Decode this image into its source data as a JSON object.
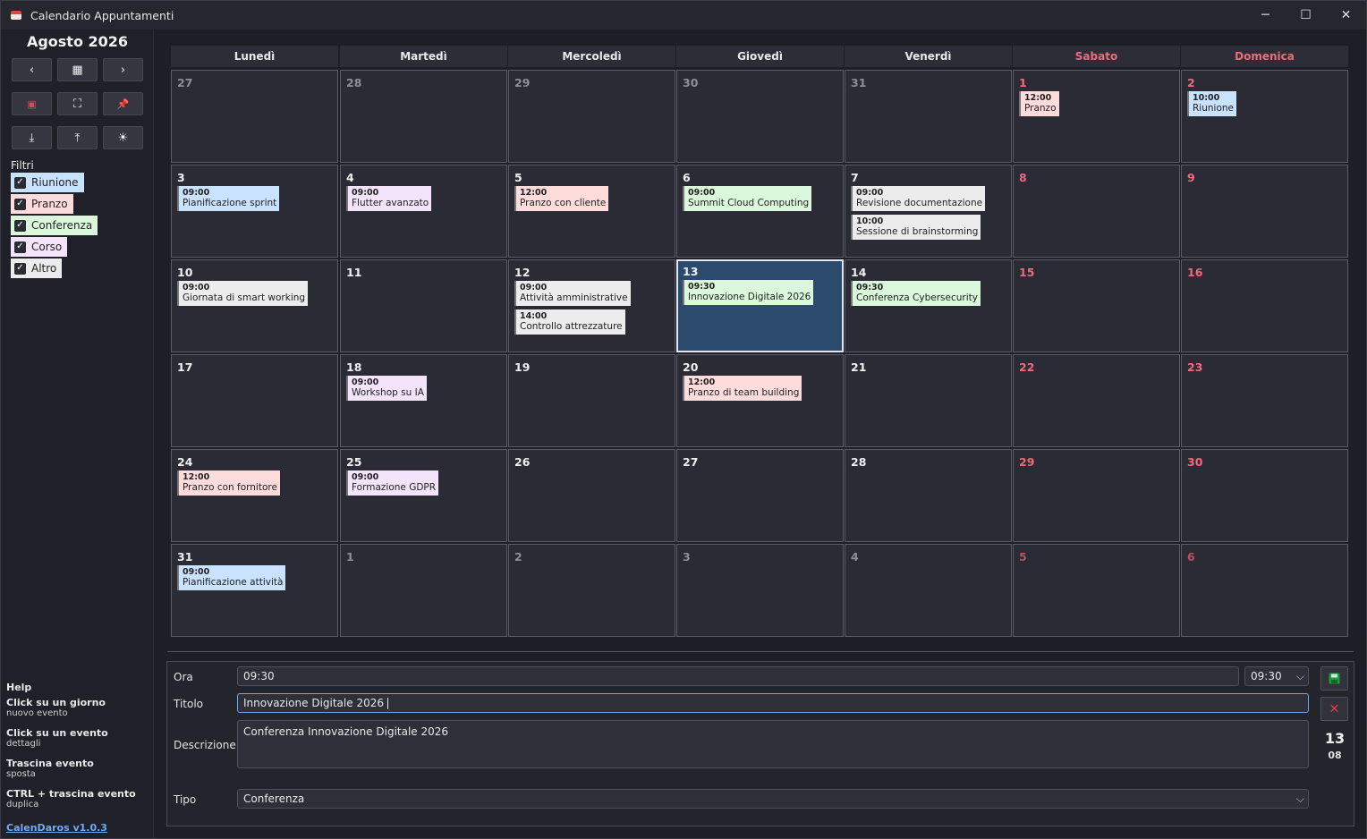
{
  "window": {
    "title": "Calendario Appuntamenti",
    "minimize": "─",
    "maximize": "☐",
    "close": "✕"
  },
  "sidebar": {
    "month_title": "Agosto 2026",
    "buttons": [
      {
        "name": "prev-month-button",
        "icon": "chevron-left-icon",
        "glyph": "‹"
      },
      {
        "name": "today-button",
        "icon": "calendar-icon",
        "glyph": "▦"
      },
      {
        "name": "next-month-button",
        "icon": "chevron-right-icon",
        "glyph": "›"
      },
      {
        "name": "language-button",
        "icon": "uk-flag-icon",
        "glyph": "▣"
      },
      {
        "name": "fullscreen-button",
        "icon": "expand-icon",
        "glyph": "⛶"
      },
      {
        "name": "pin-button",
        "icon": "pin-icon",
        "glyph": "📌"
      },
      {
        "name": "import-button",
        "icon": "download-icon",
        "glyph": "⤓"
      },
      {
        "name": "export-button",
        "icon": "upload-icon",
        "glyph": "⤒"
      },
      {
        "name": "theme-button",
        "icon": "sun-icon",
        "glyph": "☀"
      }
    ],
    "filters_label": "Filtri",
    "filters": [
      {
        "label": "Riunione",
        "color": "#c9e2ff",
        "checked": true
      },
      {
        "label": "Pranzo",
        "color": "#ffdcdc",
        "checked": true
      },
      {
        "label": "Conferenza",
        "color": "#dcf8dc",
        "checked": true
      },
      {
        "label": "Corso",
        "color": "#f3e3fb",
        "checked": true
      },
      {
        "label": "Altro",
        "color": "#ececec",
        "checked": true
      }
    ],
    "help_title": "Help",
    "help": [
      {
        "action": "Click su un giorno",
        "result": "nuovo evento"
      },
      {
        "action": "Click su un evento",
        "result": "dettagli"
      },
      {
        "action": "Trascina evento",
        "result": "sposta"
      },
      {
        "action": "CTRL + trascina evento",
        "result": "duplica"
      }
    ],
    "version": "CalenDaros v1.0.3"
  },
  "calendar": {
    "weekdays": [
      "Lunedì",
      "Martedì",
      "Mercoledì",
      "Giovedì",
      "Venerdì",
      "Sabato",
      "Domenica"
    ],
    "weeks": [
      [
        {
          "day": "27",
          "other": true
        },
        {
          "day": "28",
          "other": true
        },
        {
          "day": "29",
          "other": true
        },
        {
          "day": "30",
          "other": true
        },
        {
          "day": "31",
          "other": true
        },
        {
          "day": "1",
          "events": [
            {
              "time": "12:00",
              "title": "Pranzo",
              "type": "pranzo"
            }
          ]
        },
        {
          "day": "2",
          "events": [
            {
              "time": "10:00",
              "title": "Riunione",
              "type": "riunione"
            }
          ]
        }
      ],
      [
        {
          "day": "3",
          "events": [
            {
              "time": "09:00",
              "title": "Pianificazione sprint",
              "type": "riunione"
            }
          ]
        },
        {
          "day": "4",
          "events": [
            {
              "time": "09:00",
              "title": "Flutter avanzato",
              "type": "corso"
            }
          ]
        },
        {
          "day": "5",
          "events": [
            {
              "time": "12:00",
              "title": "Pranzo con cliente",
              "type": "pranzo"
            }
          ]
        },
        {
          "day": "6",
          "events": [
            {
              "time": "09:00",
              "title": "Summit Cloud Computing",
              "type": "conferenza"
            }
          ]
        },
        {
          "day": "7",
          "events": [
            {
              "time": "09:00",
              "title": "Revisione documentazione",
              "type": "altro"
            },
            {
              "time": "10:00",
              "title": "Sessione di brainstorming",
              "type": "altro"
            }
          ]
        },
        {
          "day": "8"
        },
        {
          "day": "9"
        }
      ],
      [
        {
          "day": "10",
          "events": [
            {
              "time": "09:00",
              "title": "Giornata di smart working",
              "type": "altro"
            }
          ]
        },
        {
          "day": "11"
        },
        {
          "day": "12",
          "events": [
            {
              "time": "09:00",
              "title": "Attività amministrative",
              "type": "altro"
            },
            {
              "time": "14:00",
              "title": "Controllo attrezzature",
              "type": "altro"
            }
          ]
        },
        {
          "day": "13",
          "selected": true,
          "events": [
            {
              "time": "09:30",
              "title": "Innovazione Digitale 2026",
              "type": "conferenza"
            }
          ]
        },
        {
          "day": "14",
          "events": [
            {
              "time": "09:30",
              "title": "Conferenza Cybersecurity",
              "type": "conferenza"
            }
          ]
        },
        {
          "day": "15"
        },
        {
          "day": "16"
        }
      ],
      [
        {
          "day": "17"
        },
        {
          "day": "18",
          "events": [
            {
              "time": "09:00",
              "title": "Workshop su IA",
              "type": "corso"
            }
          ]
        },
        {
          "day": "19"
        },
        {
          "day": "20",
          "events": [
            {
              "time": "12:00",
              "title": "Pranzo di team building",
              "type": "pranzo"
            }
          ]
        },
        {
          "day": "21"
        },
        {
          "day": "22"
        },
        {
          "day": "23"
        }
      ],
      [
        {
          "day": "24",
          "events": [
            {
              "time": "12:00",
              "title": "Pranzo con fornitore",
              "type": "pranzo"
            }
          ]
        },
        {
          "day": "25",
          "events": [
            {
              "time": "09:00",
              "title": "Formazione GDPR",
              "type": "corso"
            }
          ]
        },
        {
          "day": "26"
        },
        {
          "day": "27"
        },
        {
          "day": "28"
        },
        {
          "day": "29"
        },
        {
          "day": "30"
        }
      ],
      [
        {
          "day": "31",
          "events": [
            {
              "time": "09:00",
              "title": "Pianificazione attività",
              "type": "riunione"
            }
          ]
        },
        {
          "day": "1",
          "other": true
        },
        {
          "day": "2",
          "other": true
        },
        {
          "day": "3",
          "other": true
        },
        {
          "day": "4",
          "other": true
        },
        {
          "day": "5",
          "other": true
        },
        {
          "day": "6",
          "other": true
        }
      ]
    ]
  },
  "editor": {
    "ora_label": "Ora",
    "ora_value": "09:30",
    "ora_select": "09:30",
    "titolo_label": "Titolo",
    "titolo_value": "Innovazione Digitale 2026",
    "descrizione_label": "Descrizione",
    "descrizione_value": "Conferenza Innovazione Digitale 2026",
    "tipo_label": "Tipo",
    "tipo_value": "Conferenza",
    "save_icon": "save-icon",
    "delete_icon": "close-icon",
    "date_day": "13",
    "date_month": "08"
  }
}
